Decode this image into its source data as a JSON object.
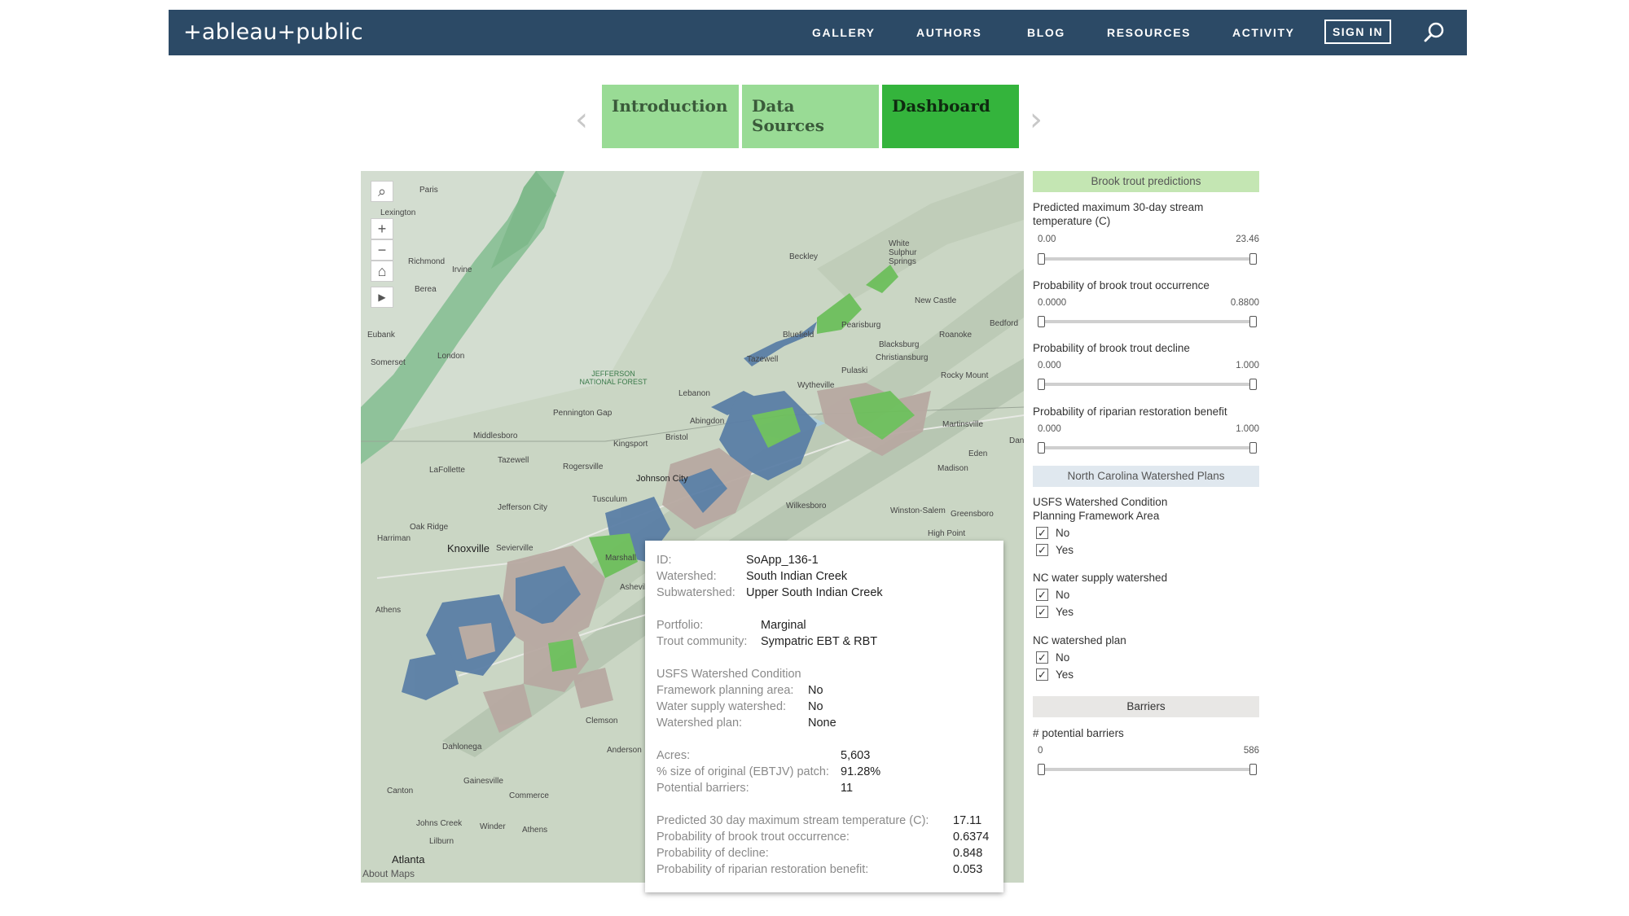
{
  "header": {
    "logo": "+ableau+public",
    "nav": [
      "GALLERY",
      "AUTHORS",
      "BLOG",
      "RESOURCES",
      "ACTIVITY"
    ],
    "sign_in": "SIGN IN",
    "icons": {
      "search": "search-icon"
    }
  },
  "tabs": [
    "Introduction",
    "Data Sources",
    "Dashboard"
  ],
  "active_tab": "Dashboard",
  "colors": {
    "nav_bg": "#2c4a66",
    "tab_light": "#99db95",
    "tab_active": "#34b43c",
    "watershed_blue": "#5b7fa6",
    "watershed_green": "#6dbf5c",
    "watershed_tan": "#b8a9a2"
  },
  "map": {
    "places": [
      "Paris",
      "Lexington",
      "Richmond",
      "Berea",
      "Irvine",
      "Eubank",
      "Somerset",
      "London",
      "JEFFERSON NATIONAL FOREST",
      "Beckley",
      "White Sulphur Springs",
      "Bluefield",
      "Pearisburg",
      "Tazewell",
      "New Castle",
      "Roanoke",
      "Bedford",
      "Blacksburg",
      "Christiansburg",
      "Pulaski",
      "Rocky Mount",
      "Wytheville",
      "Lebanon",
      "Abingdon",
      "Pennington Gap",
      "Middlesboro",
      "Bristol",
      "Kingsport",
      "Martinsville",
      "Eden",
      "Tazewell",
      "Rogersville",
      "Johnson City",
      "LaFollette",
      "Jefferson City",
      "Tusculum",
      "Danville",
      "Madison",
      "Wilkesboro",
      "Winston-Salem",
      "Greensboro",
      "High Point",
      "Oak Ridge",
      "Harriman",
      "Knoxville",
      "Sevierville",
      "Marshall",
      "Asheville",
      "Athens",
      "Clemson",
      "Anderson",
      "Dahlonega",
      "Gainesville",
      "Canton",
      "Commerce",
      "Johns Creek",
      "Winder",
      "Athens",
      "Lilburn",
      "Atlanta"
    ],
    "about": "About Maps",
    "controls": [
      "search-icon",
      "plus-icon",
      "minus-icon",
      "home-icon",
      "play-icon"
    ]
  },
  "tooltip": {
    "id": {
      "label": "ID:",
      "value": "SoApp_136-1"
    },
    "watershed": {
      "label": "Watershed:",
      "value": "South Indian Creek"
    },
    "subwatershed": {
      "label": "Subwatershed:",
      "value": "Upper South Indian Creek"
    },
    "portfolio": {
      "label": "Portfolio:",
      "value": "Marginal"
    },
    "trout_community": {
      "label": "Trout community:",
      "value": "Sympatric EBT & RBT"
    },
    "usfs_heading": "USFS Watershed Condition",
    "framework": {
      "label": "Framework planning area:",
      "value": "No"
    },
    "water_supply": {
      "label": "Water supply watershed:",
      "value": "No"
    },
    "watershed_plan": {
      "label": "Watershed plan:",
      "value": "None"
    },
    "acres": {
      "label": "Acres:",
      "value": "5,603"
    },
    "pct_size": {
      "label": "% size of original (EBTJV) patch:",
      "value": "91.28%"
    },
    "barriers": {
      "label": "Potential barriers:",
      "value": "11"
    },
    "pred_temp": {
      "label": "Predicted 30 day maximum stream temperature (C):",
      "value": "17.11"
    },
    "prob_occ": {
      "label": "Probability of brook trout occurrence:",
      "value": "0.6374"
    },
    "prob_decline": {
      "label": "Probability of decline:",
      "value": "0.848"
    },
    "prob_riparian": {
      "label": "Probability of riparian restoration benefit:",
      "value": "0.053"
    }
  },
  "panel": {
    "brook_trout_header": "Brook trout predictions",
    "filters": [
      {
        "label": "Predicted maximum 30-day stream temperature (C)",
        "min": "0.00",
        "max": "23.46"
      },
      {
        "label": "Probability of brook trout occurrence",
        "min": "0.0000",
        "max": "0.8800"
      },
      {
        "label": "Probability of brook trout decline",
        "min": "0.000",
        "max": "1.000"
      },
      {
        "label": "Probability of riparian restoration benefit",
        "min": "0.000",
        "max": "1.000"
      }
    ],
    "nc_header": "North Carolina Watershed Plans",
    "checks": [
      {
        "label": "USFS Watershed Condition Planning Framework Area",
        "options": [
          "No",
          "Yes"
        ]
      },
      {
        "label": "NC water supply watershed",
        "options": [
          "No",
          "Yes"
        ]
      },
      {
        "label": "NC watershed plan",
        "options": [
          "No",
          "Yes"
        ]
      }
    ],
    "check_mark": "✓",
    "barriers_header": "Barriers",
    "barriers_filter": {
      "label": "# potential barriers",
      "min": "0",
      "max": "586"
    }
  }
}
